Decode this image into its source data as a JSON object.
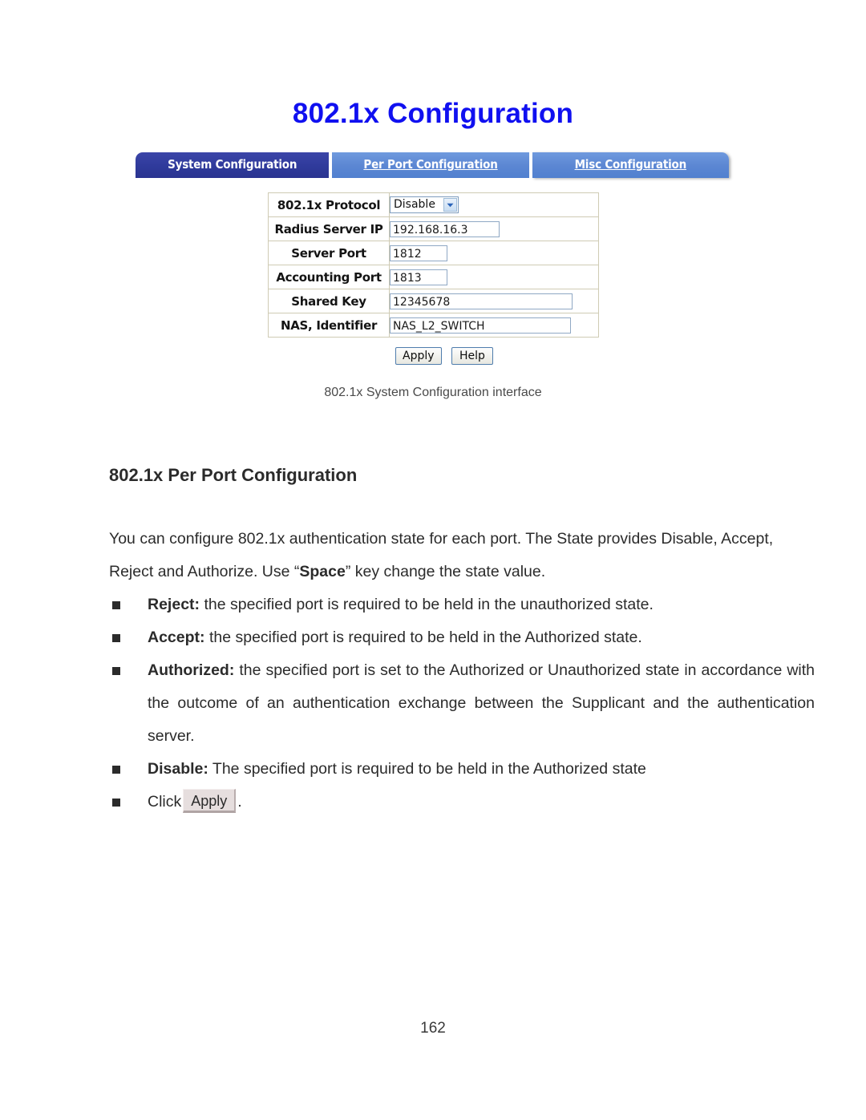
{
  "page": {
    "title": "802.1x Configuration",
    "number": "162"
  },
  "screenshot": {
    "tabs": [
      {
        "label": "System Configuration",
        "active": true
      },
      {
        "label": "Per Port Configuration",
        "active": false
      },
      {
        "label": "Misc Configuration",
        "active": false
      }
    ],
    "form": {
      "rows": [
        {
          "label": "802.1x Protocol",
          "value": "Disable",
          "control": "select"
        },
        {
          "label": "Radius Server IP",
          "value": "192.168.16.3",
          "control": "text"
        },
        {
          "label": "Server Port",
          "value": "1812",
          "control": "text"
        },
        {
          "label": "Accounting Port",
          "value": "1813",
          "control": "text"
        },
        {
          "label": "Shared Key",
          "value": "12345678",
          "control": "text"
        },
        {
          "label": "NAS, Identifier",
          "value": "NAS_L2_SWITCH",
          "control": "text"
        }
      ]
    },
    "buttons": {
      "apply": "Apply",
      "help": "Help"
    },
    "caption": "802.1x System Configuration interface",
    "colors": {
      "tab_active": "#2f3a9b",
      "tab_inactive": "#5c87d3",
      "title": "#1010f0",
      "table_border": "#cfcbb4",
      "input_border": "#8fa8c4"
    }
  },
  "content": {
    "heading": "802.1x Per Port Configuration",
    "intro_part1": "You can configure 802.1x authentication state for each port. The State provides Disable, Accept, Reject and Authorize. Use “",
    "intro_bold": "Space",
    "intro_part2": "” key change the state value.",
    "bullets": [
      {
        "term": "Reject:",
        "text": " the specified port is required to be held in the unauthorized state."
      },
      {
        "term": "Accept:",
        "text": " the specified port is required to be held in the Authorized state."
      },
      {
        "term": "Authorized:",
        "text": " the specified port is set to the Authorized or Unauthorized state in accordance with the outcome of an authentication exchange between the Supplicant and the authentication server."
      },
      {
        "term": "Disable:",
        "text": " The specified port is required to be held in the Authorized state"
      }
    ],
    "click_label": "Click",
    "click_button": "Apply",
    "click_period": "."
  }
}
